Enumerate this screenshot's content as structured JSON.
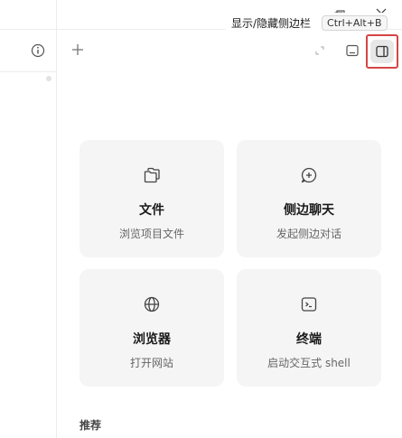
{
  "titlebar": {
    "tooltip_text": "显示/隐藏侧边栏",
    "tooltip_shortcut": "Ctrl+Alt+B"
  },
  "header": {
    "new_tab_icon": "plus-icon",
    "expand_icon": "expand-icon",
    "panel_icon": "bottom-panel-icon",
    "toggle_sidebar_icon": "sidebar-toggle-icon"
  },
  "cards": [
    {
      "icon": "files-icon",
      "title": "文件",
      "subtitle": "浏览项目文件"
    },
    {
      "icon": "chat-plus-icon",
      "title": "侧边聊天",
      "subtitle": "发起侧边对话"
    },
    {
      "icon": "globe-icon",
      "title": "浏览器",
      "subtitle": "打开网站"
    },
    {
      "icon": "terminal-icon",
      "title": "终端",
      "subtitle": "启动交互式 shell"
    }
  ],
  "recommend": {
    "label": "推荐"
  },
  "colors": {
    "card_bg": "#f5f5f5",
    "highlight_border": "#d64545",
    "toggle_bg": "#e7e7e7"
  }
}
